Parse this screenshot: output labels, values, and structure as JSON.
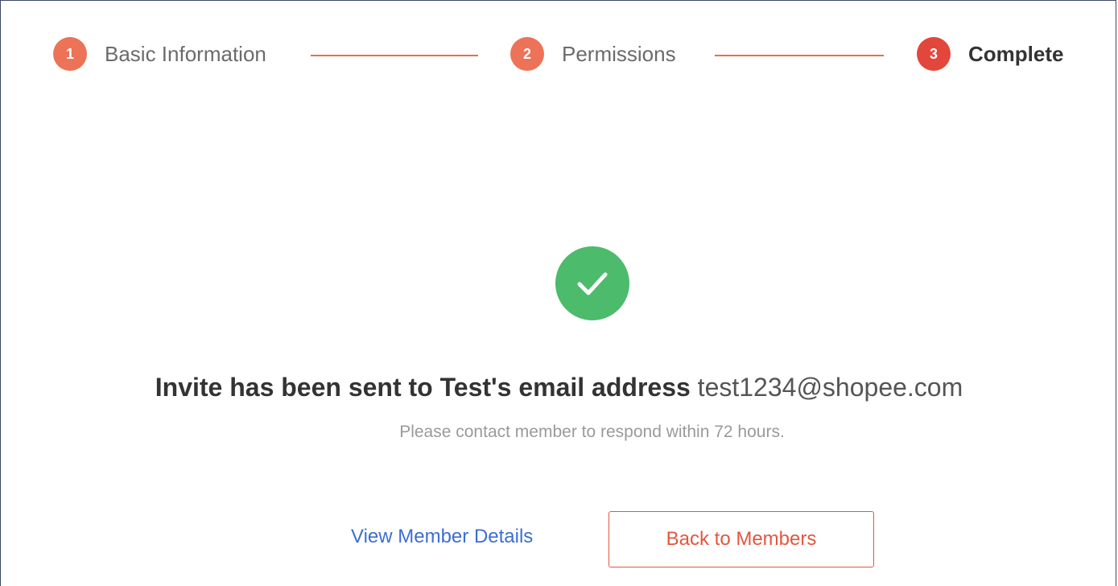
{
  "stepper": {
    "steps": [
      {
        "number": "1",
        "label": "Basic Information",
        "state": "done"
      },
      {
        "number": "2",
        "label": "Permissions",
        "state": "done"
      },
      {
        "number": "3",
        "label": "Complete",
        "state": "active"
      }
    ]
  },
  "colors": {
    "accent": "#e3563f",
    "done_badge": "#ec7358",
    "success": "#4cbb6c",
    "link": "#3c6ed3"
  },
  "success": {
    "icon": "check-icon",
    "headline": "Invite has been sent to Test's email address",
    "email": "test1234@shopee.com",
    "subtext": "Please contact member to respond within 72 hours."
  },
  "actions": {
    "view_details": "View Member Details",
    "back": "Back to Members"
  }
}
